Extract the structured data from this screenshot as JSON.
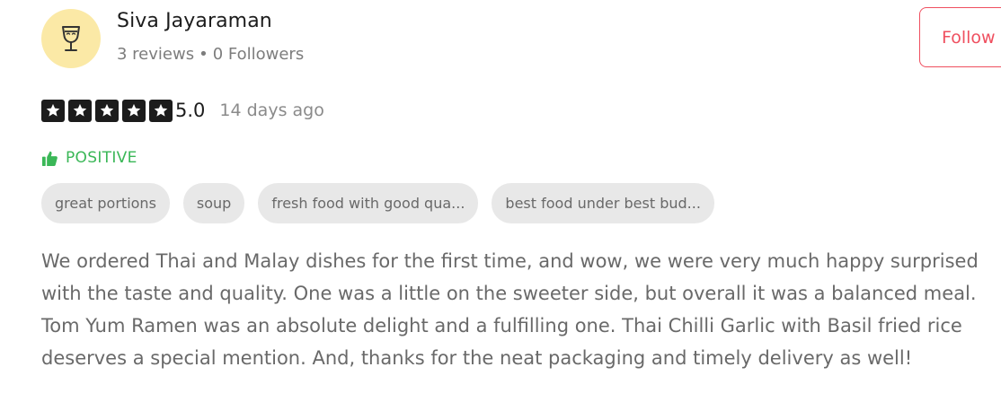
{
  "user": {
    "name": "Siva Jayaraman",
    "reviews": "3 reviews",
    "separator": "•",
    "followers": "0 Followers",
    "avatar_icon": "wine-glass-icon",
    "avatar_bg": "#fbe9a6"
  },
  "actions": {
    "follow_label": "Follow"
  },
  "rating": {
    "stars": 5,
    "value": "5.0",
    "time_ago": "14 days ago",
    "star_icon": "star-icon"
  },
  "sentiment": {
    "label": "POSITIVE",
    "icon": "thumbs-up-icon",
    "color": "#3ab757"
  },
  "tags": [
    "great portions",
    "soup",
    "fresh food with good qua...",
    "best food under best bud..."
  ],
  "review": {
    "text": "We ordered Thai and Malay dishes for the first time, and wow, we were very much happy surprised with the taste and quality. One was a little on the sweeter side, but overall it was a balanced meal. Tom Yum Ramen was an absolute delight and a fulfilling one. Thai Chilli Garlic with Basil fried rice deserves a special mention. And, thanks for the neat packaging and timely delivery as well!"
  },
  "colors": {
    "accent": "#ef4f5f",
    "star_bg": "#1c1c1c",
    "tag_bg": "#e8e8e8"
  }
}
